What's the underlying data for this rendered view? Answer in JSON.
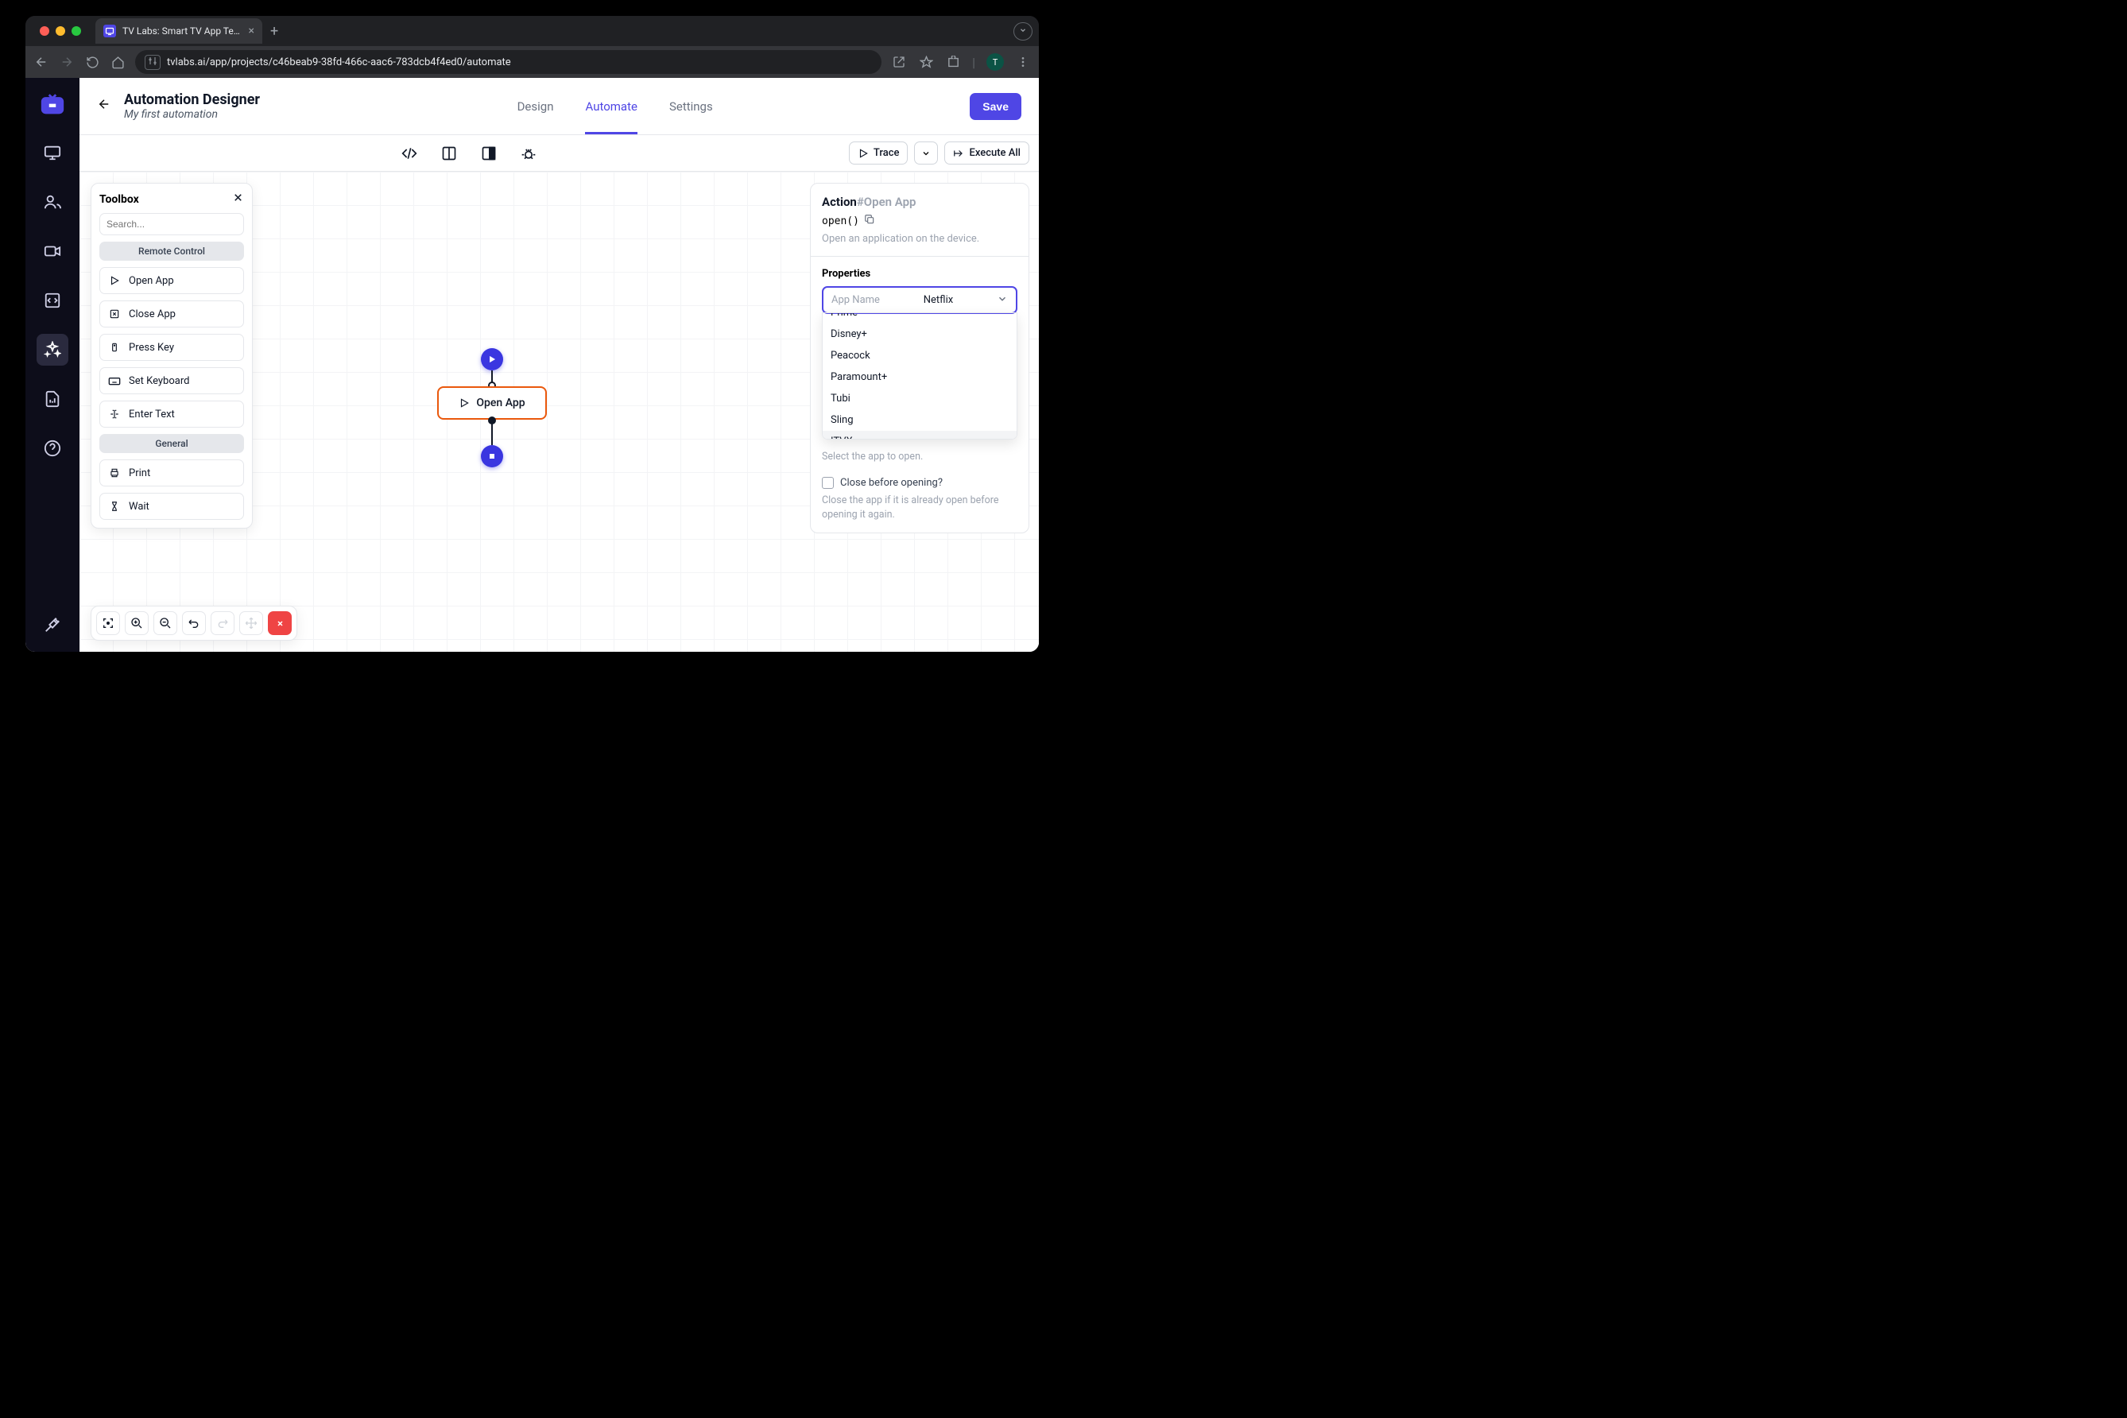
{
  "browser": {
    "tab_title": "TV Labs: Smart TV App Testin",
    "url": "tvlabs.ai/app/projects/c46beab9-38fd-466c-aac6-783dcb4f4ed0/automate",
    "profile_initial": "T"
  },
  "header": {
    "title": "Automation Designer",
    "subtitle": "My first automation",
    "tabs": {
      "design": "Design",
      "automate": "Automate",
      "settings": "Settings"
    },
    "save": "Save"
  },
  "sub_toolbar": {
    "trace": "Trace",
    "execute_all": "Execute All"
  },
  "toolbox": {
    "title": "Toolbox",
    "search_placeholder": "Search...",
    "sections": {
      "remote_control": "Remote Control",
      "general": "General"
    },
    "items": {
      "open_app": "Open App",
      "close_app": "Close App",
      "press_key": "Press Key",
      "set_keyboard": "Set Keyboard",
      "enter_text": "Enter Text",
      "print": "Print",
      "wait": "Wait"
    }
  },
  "canvas": {
    "action_label": "Open App"
  },
  "props": {
    "title_prefix": "Action",
    "title_suffix": "#Open App",
    "code": "open()",
    "description": "Open an application on the device.",
    "section_title": "Properties",
    "app_name_label": "App Name",
    "app_name_value": "Netflix",
    "dropdown_options": [
      "Prime",
      "Disney+",
      "Peacock",
      "Paramount+",
      "Tubi",
      "Sling",
      "ITVX"
    ],
    "help_select": "Select the app to open.",
    "checkbox_label": "Close before opening?",
    "help_checkbox": "Close the app if it is already open before opening it again."
  }
}
